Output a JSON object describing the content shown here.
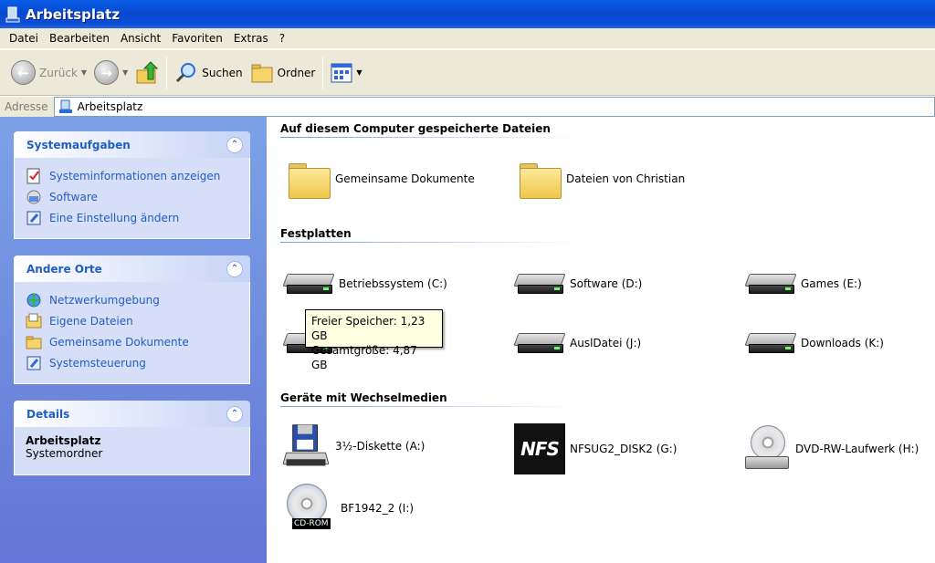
{
  "window": {
    "title": "Arbeitsplatz"
  },
  "menu": [
    "Datei",
    "Bearbeiten",
    "Ansicht",
    "Favoriten",
    "Extras",
    "?"
  ],
  "toolbar": {
    "back": "Zurück",
    "search": "Suchen",
    "folders": "Ordner"
  },
  "address": {
    "label": "Adresse",
    "value": "Arbeitsplatz"
  },
  "sidebar": {
    "system_tasks": {
      "title": "Systemaufgaben",
      "items": [
        "Systeminformationen anzeigen",
        "Software",
        "Eine Einstellung ändern"
      ]
    },
    "other_places": {
      "title": "Andere Orte",
      "items": [
        "Netzwerkumgebung",
        "Eigene Dateien",
        "Gemeinsame Dokumente",
        "Systemsteuerung"
      ]
    },
    "details": {
      "title": "Details",
      "name": "Arbeitsplatz",
      "type": "Systemordner"
    }
  },
  "sections": {
    "stored_files": "Auf diesem Computer gespeicherte Dateien",
    "hard_disks": "Festplatten",
    "removable": "Geräte mit Wechselmedien"
  },
  "stored_files": [
    "Gemeinsame Dokumente",
    "Dateien von Christian"
  ],
  "hard_disks": [
    "Betriebssystem (C:)",
    "Software (D:)",
    "Games (E:)",
    "AuslDatei (J:)",
    "Downloads (K:)"
  ],
  "removable": [
    "3½-Diskette (A:)",
    "NFSUG2_DISK2 (G:)",
    "DVD-RW-Laufwerk (H:)",
    "BF1942_2 (I:)"
  ],
  "nfs_logo_text": "NFS",
  "cdrom_badge": "CD-ROM",
  "tooltip": {
    "line1": "Freier Speicher: 1,23 GB",
    "line2": "Gesamtgröße: 4,87 GB"
  }
}
